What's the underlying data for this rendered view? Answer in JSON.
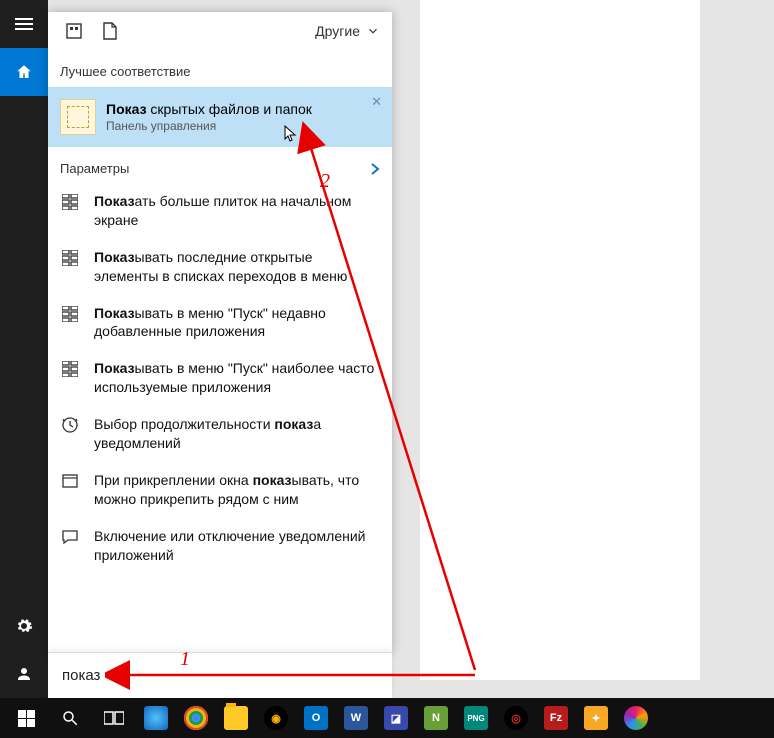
{
  "header": {
    "other_label": "Другие"
  },
  "best_match_section": "Лучшее соответствие",
  "best_match": {
    "bold": "Показ",
    "rest": " скрытых файлов и папок",
    "subtitle": "Панель управления"
  },
  "settings_section": "Параметры",
  "settings": [
    {
      "icon": "tiles",
      "bold": "Показ",
      "rest": "ать больше плиток на начальном экране"
    },
    {
      "icon": "tiles",
      "bold": "Показ",
      "rest": "ывать последние открытые элементы в списках переходов в меню"
    },
    {
      "icon": "tiles",
      "bold": "Показ",
      "rest": "ывать в меню \"Пуск\" недавно добавленные приложения"
    },
    {
      "icon": "tiles",
      "bold": "Показ",
      "rest": "ывать в меню \"Пуск\" наиболее часто используемые приложения"
    },
    {
      "icon": "clock",
      "pre": "Выбор продолжительности ",
      "bold": "показ",
      "rest": "а уведомлений"
    },
    {
      "icon": "window",
      "pre": "При прикреплении окна ",
      "bold": "показ",
      "rest": "ывать, что можно прикрепить рядом с ним"
    },
    {
      "icon": "chat",
      "pre": "Включение или отключение уведомлений приложений",
      "bold": "",
      "rest": ""
    }
  ],
  "search_value": "показ",
  "annotations": {
    "label1": "1",
    "label2": "2"
  },
  "taskbar": [
    "ie",
    "chrome",
    "files",
    "aimp",
    "outlook",
    "word",
    "img1",
    "npp",
    "png",
    "od",
    "fz",
    "misc",
    "picasa"
  ]
}
